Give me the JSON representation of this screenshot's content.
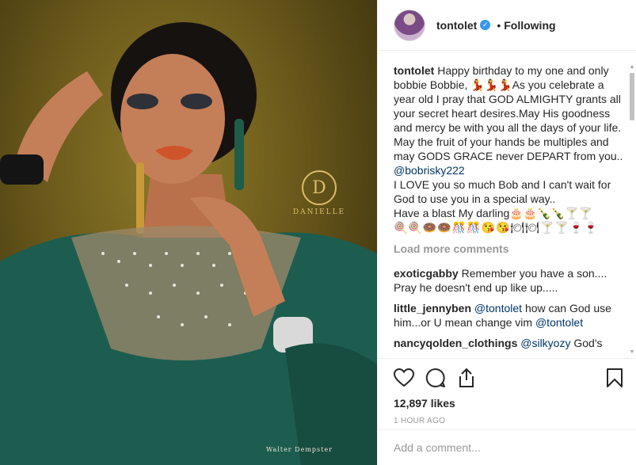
{
  "photo": {
    "watermark_logo_letter": "D",
    "watermark_logo_name": "DANIELLE",
    "photographer_credit": "Walter Dempster"
  },
  "header": {
    "username": "tontolet",
    "separator": "•",
    "follow_status": "Following",
    "verified_icon": "verified-check-icon"
  },
  "caption": {
    "author": "tontolet",
    "part1": "Happy birthday to my one and only bobbie Bobbie, 💃💃💃As you celebrate a year old I pray that GOD ALMIGHTY grants all your secret heart desires.May His goodness and mercy be with you all the days of your life.",
    "part2": "May the fruit of your hands be multiples and may GODS GRACE never DEPART from you..",
    "mention": "@bobrisky222",
    "part3": "I LOVE you so much Bob and I can't wait for God to use you in a special way..",
    "part4": "Have a blast My darling🎂🎂🍾🍾🍸🍸",
    "emoji_line": "🍭🍭🍩🍩🎊🎊😘😘🍽🍽🍸🍸🍷🍷"
  },
  "load_more": "Load more comments",
  "comments": [
    {
      "author": "exoticgabby",
      "text": "Remember you have a son.... Pray he doesn't end up like up....."
    },
    {
      "author": "little_jennyben",
      "mention1": "@tontolet",
      "text": "how can God use him...or U mean change vim",
      "mention2": "@tontolet"
    },
    {
      "author": "nancyqolden_clothings",
      "mention1": "@silkyozy",
      "text": "God's"
    }
  ],
  "actions": {
    "like_icon": "heart-icon",
    "comment_icon": "comment-bubble-icon",
    "share_icon": "share-icon",
    "save_icon": "bookmark-icon",
    "likes": "12,897 likes",
    "time": "1 HOUR AGO"
  },
  "add_comment": {
    "placeholder": "Add a comment..."
  },
  "colors": {
    "link": "#003569",
    "verified": "#3897f0",
    "muted": "#999999",
    "text": "#262626"
  }
}
